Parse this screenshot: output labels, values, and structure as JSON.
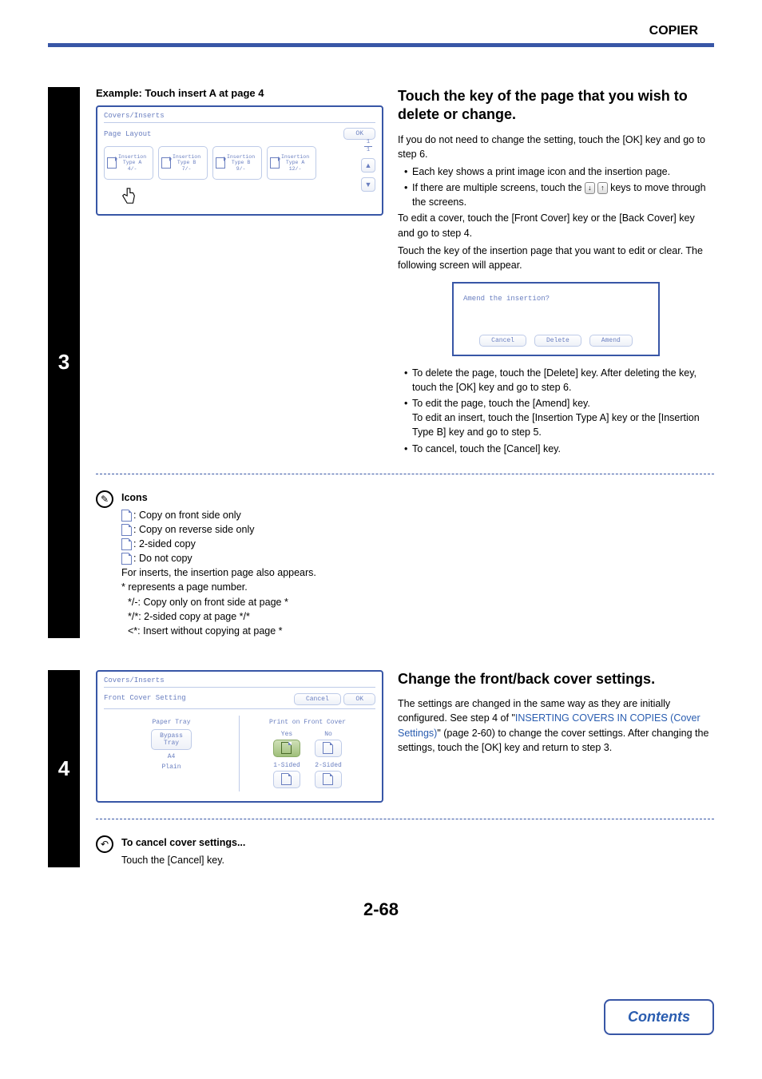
{
  "header": {
    "chapter": "COPIER"
  },
  "pageNumber": "2-68",
  "contentsLabel": "Contents",
  "step3": {
    "number": "3",
    "exampleLabel": "Example: Touch insert A at page 4",
    "panel": {
      "title": "Covers/Inserts",
      "subHeader": "Page Layout",
      "okLabel": "OK",
      "pageIndicator": {
        "current": "1",
        "total": "1"
      },
      "cards": [
        {
          "line1": "Insertion",
          "line2": "Type A",
          "line3": "4/-"
        },
        {
          "line1": "Insertion",
          "line2": "Type B",
          "line3": "7/-"
        },
        {
          "line1": "Insertion",
          "line2": "Type B",
          "line3": "9/-"
        },
        {
          "line1": "Insertion",
          "line2": "Type A",
          "line3": "12/-"
        }
      ]
    },
    "title": "Touch the key of the page that you wish to delete or change.",
    "text1": "If you do not need to change the setting, touch the [OK] key and go to step 6.",
    "bullet1": "Each key shows a print image icon and the insertion page.",
    "bullet2a": "If there are multiple screens, touch the ",
    "bullet2b": " keys to move through the screens.",
    "text2": "To edit a cover, touch the [Front Cover] key or the [Back Cover] key and go to step 4.",
    "text3": "Touch the key of the insertion page that you want to edit or clear. The following screen will appear.",
    "amendPanel": {
      "question": "Amend the insertion?",
      "cancel": "Cancel",
      "delete": "Delete",
      "amend": "Amend"
    },
    "afterBullets": [
      "To delete the page, touch the [Delete] key. After deleting the key, touch the [OK] key and go to step 6.",
      "To edit the page, touch the [Amend] key.\nTo edit an insert, touch the [Insertion Type A] key or the [Insertion Type B] key and go to step 5.",
      "To cancel, touch the [Cancel] key."
    ],
    "iconsNote": {
      "heading": "Icons",
      "lines": [
        ": Copy on front side only",
        ": Copy on reverse side only",
        ": 2-sided copy",
        ": Do not copy"
      ],
      "extra1": "For inserts, the insertion page also appears.",
      "extra2": "* represents a page number.",
      "extra3": "*/-: Copy only on front side at page *",
      "extra4": "*/*: 2-sided copy at page */*",
      "extra5": "<*: Insert without copying at page *"
    }
  },
  "step4": {
    "number": "4",
    "panel": {
      "title": "Covers/Inserts",
      "subHeader": "Front Cover Setting",
      "cancelLabel": "Cancel",
      "okLabel": "OK",
      "leftHeading": "Paper Tray",
      "trayBtn": "Bypass\nTray",
      "size": "A4",
      "type": "Plain",
      "rightHeading": "Print on Front Cover",
      "yes": "Yes",
      "no": "No",
      "oneSided": "1-Sided",
      "twoSided": "2-Sided"
    },
    "title": "Change the front/back cover settings.",
    "text1a": "The settings are changed in the same way as they are initially configured. See step 4 of \"",
    "linkText": "INSERTING COVERS IN COPIES (Cover Settings)",
    "text1b": "\" (page 2-60) to change the cover settings. After changing the settings, touch the [OK] key and return to step 3.",
    "cancelNote": {
      "heading": "To cancel cover settings...",
      "text": "Touch the [Cancel] key."
    }
  }
}
